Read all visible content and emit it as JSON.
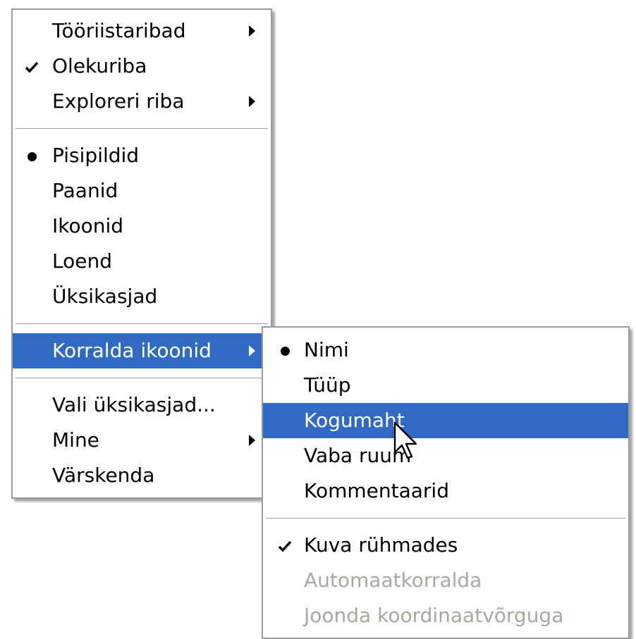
{
  "main_menu": {
    "items": [
      {
        "label": "Tööriistaribad",
        "mark": "",
        "submenu": true
      },
      {
        "label": "Olekuriba",
        "mark": "check",
        "submenu": false
      },
      {
        "label": "Exploreri riba",
        "mark": "",
        "submenu": true
      },
      {
        "label": "Pisipildid",
        "mark": "bullet",
        "submenu": false
      },
      {
        "label": "Paanid",
        "mark": "",
        "submenu": false
      },
      {
        "label": "Ikoonid",
        "mark": "",
        "submenu": false
      },
      {
        "label": "Loend",
        "mark": "",
        "submenu": false
      },
      {
        "label": "Üksikasjad",
        "mark": "",
        "submenu": false
      },
      {
        "label": "Korralda ikoonid",
        "mark": "",
        "submenu": true,
        "highlighted": true
      },
      {
        "label": "Vali üksikasjad...",
        "mark": "",
        "submenu": false
      },
      {
        "label": "Mine",
        "mark": "",
        "submenu": true
      },
      {
        "label": "Värskenda",
        "mark": "",
        "submenu": false
      }
    ]
  },
  "sub_menu": {
    "items": [
      {
        "label": "Nimi",
        "mark": "bullet"
      },
      {
        "label": "Tüüp",
        "mark": ""
      },
      {
        "label": "Kogumaht",
        "mark": "",
        "highlighted": true
      },
      {
        "label": "Vaba ruum",
        "mark": ""
      },
      {
        "label": "Kommentaarid",
        "mark": ""
      },
      {
        "label": "Kuva rühmades",
        "mark": "check"
      },
      {
        "label": "Automaatkorralda",
        "mark": "",
        "disabled": true
      },
      {
        "label": "Joonda koordinaatvõrguga",
        "mark": "",
        "disabled": true
      }
    ]
  },
  "colors": {
    "highlight": "#316ac5",
    "disabled_text": "#aca899",
    "menu_border": "#9a9a9a"
  },
  "icons": {
    "check": "check-icon",
    "bullet": "bullet-icon",
    "submenu": "submenu-arrow-icon",
    "cursor": "arrow-cursor-icon"
  }
}
